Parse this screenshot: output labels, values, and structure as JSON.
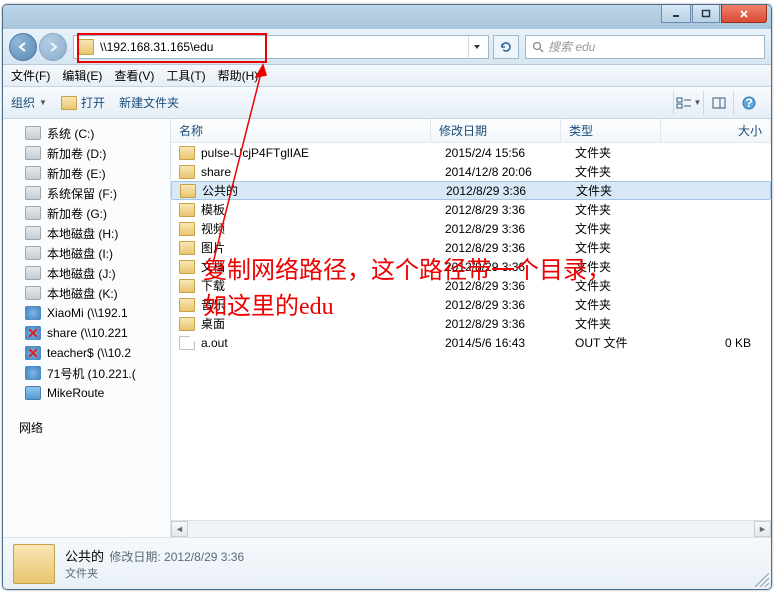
{
  "address": "\\\\192.168.31.165\\edu",
  "search_placeholder": "搜索 edu",
  "menubar": {
    "file": "文件(F)",
    "edit": "编辑(E)",
    "view": "查看(V)",
    "tools": "工具(T)",
    "help": "帮助(H)"
  },
  "toolbar": {
    "organize": "组织",
    "open": "打开",
    "newfolder": "新建文件夹"
  },
  "tree": [
    {
      "icon": "drive",
      "label": "系统 (C:)"
    },
    {
      "icon": "drive",
      "label": "新加卷 (D:)"
    },
    {
      "icon": "drive",
      "label": "新加卷 (E:)"
    },
    {
      "icon": "drive",
      "label": "系统保留 (F:)"
    },
    {
      "icon": "drive",
      "label": "新加卷 (G:)"
    },
    {
      "icon": "drive",
      "label": "本地磁盘 (H:)"
    },
    {
      "icon": "drive",
      "label": "本地磁盘 (I:)"
    },
    {
      "icon": "drive",
      "label": "本地磁盘 (J:)"
    },
    {
      "icon": "drive",
      "label": "本地磁盘 (K:)"
    },
    {
      "icon": "net",
      "label": "XiaoMi (\\\\192.1"
    },
    {
      "icon": "net",
      "label": "share (\\\\10.221"
    },
    {
      "icon": "net",
      "label": "teacher$ (\\\\10.2"
    },
    {
      "icon": "net",
      "label": "71号机 (10.221.("
    },
    {
      "icon": "router",
      "label": "MikeRoute"
    }
  ],
  "nethead": "网络",
  "columns": {
    "name": "名称",
    "date": "修改日期",
    "type": "类型",
    "size": "大小"
  },
  "files": [
    {
      "icon": "fold",
      "name": "pulse-UcjP4FTglIAE",
      "date": "2015/2/4 15:56",
      "type": "文件夹",
      "size": "",
      "sel": false
    },
    {
      "icon": "fold",
      "name": "share",
      "date": "2014/12/8 20:06",
      "type": "文件夹",
      "size": "",
      "sel": false
    },
    {
      "icon": "fold",
      "name": "公共的",
      "date": "2012/8/29 3:36",
      "type": "文件夹",
      "size": "",
      "sel": true
    },
    {
      "icon": "fold",
      "name": "模板",
      "date": "2012/8/29 3:36",
      "type": "文件夹",
      "size": "",
      "sel": false
    },
    {
      "icon": "fold",
      "name": "视频",
      "date": "2012/8/29 3:36",
      "type": "文件夹",
      "size": "",
      "sel": false
    },
    {
      "icon": "fold",
      "name": "图片",
      "date": "2012/8/29 3:36",
      "type": "文件夹",
      "size": "",
      "sel": false
    },
    {
      "icon": "fold",
      "name": "文档",
      "date": "2012/8/29 3:36",
      "type": "文件夹",
      "size": "",
      "sel": false
    },
    {
      "icon": "fold",
      "name": "下载",
      "date": "2012/8/29 3:36",
      "type": "文件夹",
      "size": "",
      "sel": false
    },
    {
      "icon": "fold",
      "name": "音乐",
      "date": "2012/8/29 3:36",
      "type": "文件夹",
      "size": "",
      "sel": false
    },
    {
      "icon": "fold",
      "name": "桌面",
      "date": "2012/8/29 3:36",
      "type": "文件夹",
      "size": "",
      "sel": false
    },
    {
      "icon": "file",
      "name": "a.out",
      "date": "2014/5/6 16:43",
      "type": "OUT 文件",
      "size": "0 KB",
      "sel": false
    }
  ],
  "details": {
    "name": "公共的",
    "type": "文件夹",
    "meta_label": "修改日期:",
    "meta_value": "2012/8/29 3:36"
  },
  "annotation": {
    "line1": "复制网络路径，这个路径带一个目录，",
    "line2": "如这里的edu"
  }
}
